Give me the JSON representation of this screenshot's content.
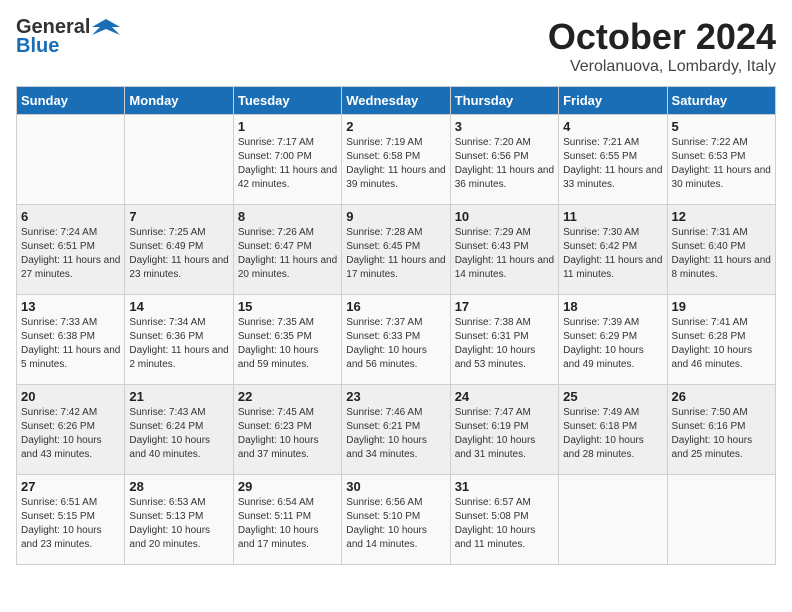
{
  "header": {
    "logo_general": "General",
    "logo_blue": "Blue",
    "month": "October 2024",
    "location": "Verolanuova, Lombardy, Italy"
  },
  "days_of_week": [
    "Sunday",
    "Monday",
    "Tuesday",
    "Wednesday",
    "Thursday",
    "Friday",
    "Saturday"
  ],
  "weeks": [
    [
      {
        "day": "",
        "content": ""
      },
      {
        "day": "",
        "content": ""
      },
      {
        "day": "1",
        "content": "Sunrise: 7:17 AM\nSunset: 7:00 PM\nDaylight: 11 hours and 42 minutes."
      },
      {
        "day": "2",
        "content": "Sunrise: 7:19 AM\nSunset: 6:58 PM\nDaylight: 11 hours and 39 minutes."
      },
      {
        "day": "3",
        "content": "Sunrise: 7:20 AM\nSunset: 6:56 PM\nDaylight: 11 hours and 36 minutes."
      },
      {
        "day": "4",
        "content": "Sunrise: 7:21 AM\nSunset: 6:55 PM\nDaylight: 11 hours and 33 minutes."
      },
      {
        "day": "5",
        "content": "Sunrise: 7:22 AM\nSunset: 6:53 PM\nDaylight: 11 hours and 30 minutes."
      }
    ],
    [
      {
        "day": "6",
        "content": "Sunrise: 7:24 AM\nSunset: 6:51 PM\nDaylight: 11 hours and 27 minutes."
      },
      {
        "day": "7",
        "content": "Sunrise: 7:25 AM\nSunset: 6:49 PM\nDaylight: 11 hours and 23 minutes."
      },
      {
        "day": "8",
        "content": "Sunrise: 7:26 AM\nSunset: 6:47 PM\nDaylight: 11 hours and 20 minutes."
      },
      {
        "day": "9",
        "content": "Sunrise: 7:28 AM\nSunset: 6:45 PM\nDaylight: 11 hours and 17 minutes."
      },
      {
        "day": "10",
        "content": "Sunrise: 7:29 AM\nSunset: 6:43 PM\nDaylight: 11 hours and 14 minutes."
      },
      {
        "day": "11",
        "content": "Sunrise: 7:30 AM\nSunset: 6:42 PM\nDaylight: 11 hours and 11 minutes."
      },
      {
        "day": "12",
        "content": "Sunrise: 7:31 AM\nSunset: 6:40 PM\nDaylight: 11 hours and 8 minutes."
      }
    ],
    [
      {
        "day": "13",
        "content": "Sunrise: 7:33 AM\nSunset: 6:38 PM\nDaylight: 11 hours and 5 minutes."
      },
      {
        "day": "14",
        "content": "Sunrise: 7:34 AM\nSunset: 6:36 PM\nDaylight: 11 hours and 2 minutes."
      },
      {
        "day": "15",
        "content": "Sunrise: 7:35 AM\nSunset: 6:35 PM\nDaylight: 10 hours and 59 minutes."
      },
      {
        "day": "16",
        "content": "Sunrise: 7:37 AM\nSunset: 6:33 PM\nDaylight: 10 hours and 56 minutes."
      },
      {
        "day": "17",
        "content": "Sunrise: 7:38 AM\nSunset: 6:31 PM\nDaylight: 10 hours and 53 minutes."
      },
      {
        "day": "18",
        "content": "Sunrise: 7:39 AM\nSunset: 6:29 PM\nDaylight: 10 hours and 49 minutes."
      },
      {
        "day": "19",
        "content": "Sunrise: 7:41 AM\nSunset: 6:28 PM\nDaylight: 10 hours and 46 minutes."
      }
    ],
    [
      {
        "day": "20",
        "content": "Sunrise: 7:42 AM\nSunset: 6:26 PM\nDaylight: 10 hours and 43 minutes."
      },
      {
        "day": "21",
        "content": "Sunrise: 7:43 AM\nSunset: 6:24 PM\nDaylight: 10 hours and 40 minutes."
      },
      {
        "day": "22",
        "content": "Sunrise: 7:45 AM\nSunset: 6:23 PM\nDaylight: 10 hours and 37 minutes."
      },
      {
        "day": "23",
        "content": "Sunrise: 7:46 AM\nSunset: 6:21 PM\nDaylight: 10 hours and 34 minutes."
      },
      {
        "day": "24",
        "content": "Sunrise: 7:47 AM\nSunset: 6:19 PM\nDaylight: 10 hours and 31 minutes."
      },
      {
        "day": "25",
        "content": "Sunrise: 7:49 AM\nSunset: 6:18 PM\nDaylight: 10 hours and 28 minutes."
      },
      {
        "day": "26",
        "content": "Sunrise: 7:50 AM\nSunset: 6:16 PM\nDaylight: 10 hours and 25 minutes."
      }
    ],
    [
      {
        "day": "27",
        "content": "Sunrise: 6:51 AM\nSunset: 5:15 PM\nDaylight: 10 hours and 23 minutes."
      },
      {
        "day": "28",
        "content": "Sunrise: 6:53 AM\nSunset: 5:13 PM\nDaylight: 10 hours and 20 minutes."
      },
      {
        "day": "29",
        "content": "Sunrise: 6:54 AM\nSunset: 5:11 PM\nDaylight: 10 hours and 17 minutes."
      },
      {
        "day": "30",
        "content": "Sunrise: 6:56 AM\nSunset: 5:10 PM\nDaylight: 10 hours and 14 minutes."
      },
      {
        "day": "31",
        "content": "Sunrise: 6:57 AM\nSunset: 5:08 PM\nDaylight: 10 hours and 11 minutes."
      },
      {
        "day": "",
        "content": ""
      },
      {
        "day": "",
        "content": ""
      }
    ]
  ]
}
